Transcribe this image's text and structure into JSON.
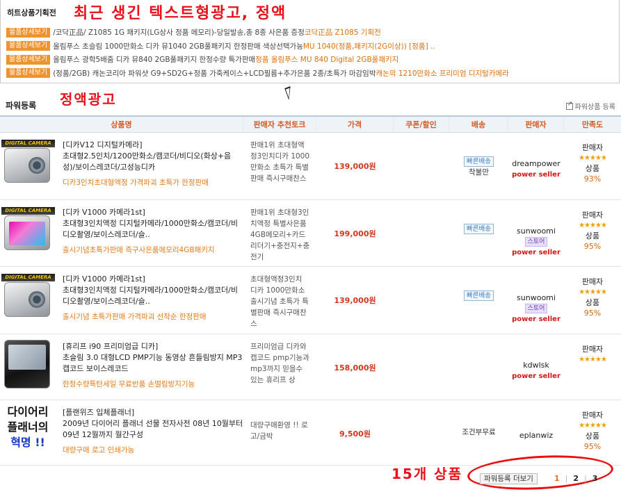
{
  "top": {
    "title": "히트상품기획전",
    "annotation": "최근 생긴 텍스트형광고, 정액",
    "ads": [
      {
        "badge": "물품상세보기",
        "main": "/코닥正品/ Z1085 1G 패키지(LG상사 정품 메모리)-당일발송,총 8종 사은품 증정",
        "accent": "코닥正品 Z1085 기획전"
      },
      {
        "badge": "물품상세보기",
        "main": "올림푸스 초슬림 1000만화소 디카 뮤1040 2GB풀패키지 한정판매 색상선택가능",
        "accent": "MU 1040(정품,패키지(2G이상)) [정품] .."
      },
      {
        "badge": "물품상세보기",
        "main": "올림푸스 광학5배줌 디카 뮤840 2GB풀패키지 한정수량 특가판매",
        "accent": "정품 올림푸스 MU 840 Digital 2GB풀패키지"
      },
      {
        "badge": "물품상세보기",
        "main": "(정품/2GB) 캐논코리아 파워샷 G9+SD2G+정품 가죽케이스+LCD필름+추가은품 2종/초특가 마감임박",
        "accent": "캐논의 1210만화소 프리미엄 디지털카메라"
      }
    ]
  },
  "power": {
    "title": "파워등록",
    "annotation": "정액광고",
    "link_label": "파워상품 등록"
  },
  "table": {
    "headers": [
      "상품명",
      "판매자 추천토크",
      "가격",
      "쿠폰/할인",
      "배송",
      "판매자",
      "만족도"
    ],
    "rows": [
      {
        "banner": "DIGITAL CAMERA VIDEO",
        "title": "[디카V12 디지털카메라]",
        "sub": "초대형2.5인치/1200만화소/캠코더/비디오(화상+음성)/보이스레코더/고성능디카",
        "promo": "디카3인치초대형액정 가격파괴 초특가 한정판매",
        "talk": "판매1위 초대형액정3인치디카 1000만화소 초특가 특별판매 즉시구매찬스",
        "price": "139,000원",
        "ship_badge": "빠른배송",
        "ship": "착불만",
        "seller": "dreampower",
        "store": "",
        "seller_grade": "power seller",
        "sat_label": "판매자",
        "stars": "★★★★★",
        "sat_label2": "상품",
        "sat": "93%"
      },
      {
        "banner": "DIGITAL CAMERA VIDEO",
        "title": "[디카 V1000 카메라1st]",
        "sub": "초대형3인치액정 디지털카메라/1000만화소/캠코더/비디오촬영/보이스레코더/슬..",
        "promo": "출시기념초특가판매 즉구사은품메모리4GB패키지",
        "talk": "판매1위 초대형3인치액정 특별사은품 4GB메모리+카드리더기+충전지+충전기",
        "price": "199,000원",
        "ship_badge": "빠른배송",
        "ship": "",
        "seller": "sunwoomi",
        "store": "스토어",
        "seller_grade": "power seller",
        "sat_label": "판매자",
        "stars": "★★★★★",
        "sat_label2": "상품",
        "sat": "95%"
      },
      {
        "banner": "DIGITAL CAMERA VIDEO",
        "title": "[디카 V1000 카메라1st]",
        "sub": "초대형3인치액정 디지털카메라/1000만화소/캠코더/비디오촬영/보이스레코더/슬..",
        "promo": "출시기념 초특가판매 가격파괴 선착순 한정판매",
        "talk": "초대형액정3인치 디카 1000만화소 출시기념 초특가 특별판매 즉시구매찬스",
        "price": "139,000원",
        "ship_badge": "빠른배송",
        "ship": "",
        "seller": "sunwoomi",
        "store": "스토어",
        "seller_grade": "power seller",
        "sat_label": "판매자",
        "stars": "★★★★★",
        "sat_label2": "상품",
        "sat": "95%"
      },
      {
        "banner": "",
        "title": "[휴리프 i90 프리미엄급 디카]",
        "sub": "초슬림 3.0 대형LCD PMP기능 동영상 흔들림방지 MP3 캡코드 보이스레코드",
        "promo": "한정수량특탄세일 무료반품 손떨림방지기능",
        "talk": "프리미엄급 디카와 캡코드 pmp기능과 mp3까지 믿을수 있는 휴리프 상",
        "price": "158,000원",
        "ship_badge": "",
        "ship": "",
        "seller": "kdwlsk",
        "store": "",
        "seller_grade": "power seller",
        "sat_label": "판매자",
        "stars": "★★★★★",
        "sat_label2": "",
        "sat": ""
      },
      {
        "banner": "",
        "diary1": "다이어리",
        "diary2": "플래너의",
        "diary3": "혁명 !!",
        "title": "[플랜위즈 입체플래너]",
        "sub": "2009년 다이어리 플래너 선물 전자사전 08년 10월부터 09년 12월까지 월간구성",
        "promo": "대량구매 로고 인쇄가능",
        "talk": "대량구매환영 !! 로고/금박",
        "price": "9,500원",
        "ship_badge": "",
        "ship": "조건부무료",
        "seller": "eplanwiz",
        "store": "",
        "seller_grade": "",
        "sat_label": "판매자",
        "stars": "★★★★★",
        "sat_label2": "상품",
        "sat": "95%"
      }
    ]
  },
  "footer": {
    "annotation": "15개 상품",
    "more_label": "파워등록 더보기",
    "pages": [
      "1",
      "2",
      "3"
    ]
  }
}
